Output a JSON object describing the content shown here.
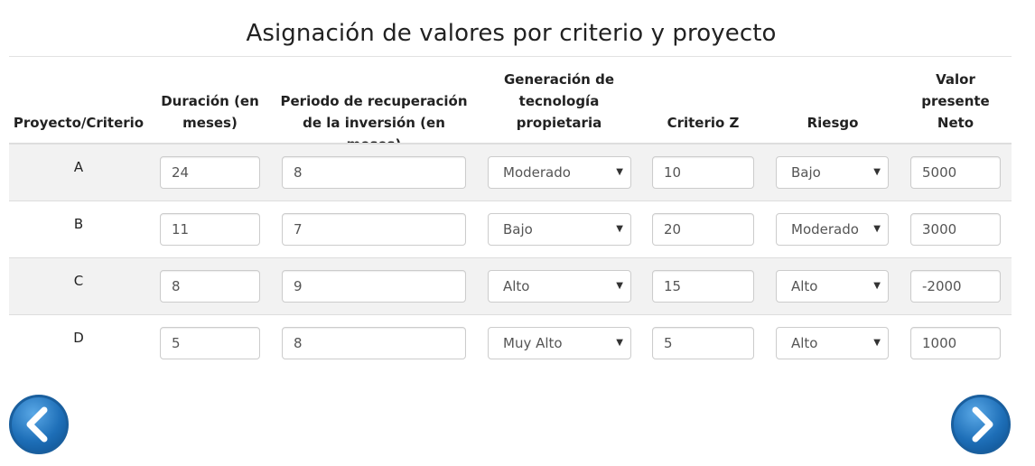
{
  "title": "Asignación de valores por criterio y proyecto",
  "headers": {
    "proyecto": "Proyecto/Criterio",
    "duracion": [
      "Duración (en",
      "meses)"
    ],
    "periodo": [
      "Periodo de recuperación",
      "de la inversión (en meses)"
    ],
    "generacion": [
      "Generación de",
      "tecnología",
      "propietaria"
    ],
    "criterio_z": "Criterio Z",
    "riesgo": "Riesgo",
    "vpn": [
      "Valor",
      "presente",
      "Neto"
    ]
  },
  "rows": [
    {
      "label": "A",
      "duracion": "24",
      "periodo": "8",
      "generacion": "Moderado",
      "criterio_z": "10",
      "riesgo": "Bajo",
      "vpn": "5000"
    },
    {
      "label": "B",
      "duracion": "11",
      "periodo": "7",
      "generacion": "Bajo",
      "criterio_z": "20",
      "riesgo": "Moderado",
      "vpn": "3000"
    },
    {
      "label": "C",
      "duracion": "8",
      "periodo": "9",
      "generacion": "Alto",
      "criterio_z": "15",
      "riesgo": "Alto",
      "vpn": "-2000"
    },
    {
      "label": "D",
      "duracion": "5",
      "periodo": "8",
      "generacion": "Muy Alto",
      "criterio_z": "5",
      "riesgo": "Alto",
      "vpn": "1000"
    }
  ],
  "nav": {
    "prev_icon": "chevron-left-icon",
    "next_icon": "chevron-right-icon"
  },
  "colors": {
    "button_blue": "#1e6fb8",
    "stripe": "#f2f2f2"
  }
}
